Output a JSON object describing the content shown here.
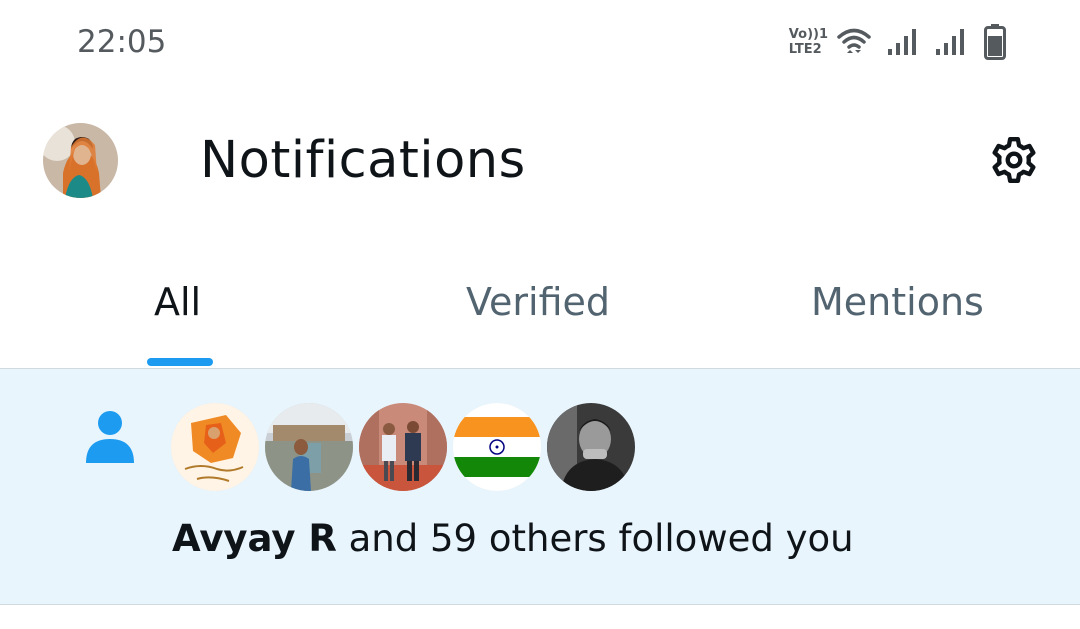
{
  "status_bar": {
    "time": "22:05",
    "volte_top": "Vo))1",
    "volte_bottom": "LTE2",
    "icons": [
      "wifi-icon",
      "signal-icon",
      "signal-icon",
      "battery-icon"
    ]
  },
  "header": {
    "title": "Notifications",
    "settings_icon": "gear-icon"
  },
  "tabs": [
    {
      "label": "All",
      "active": true
    },
    {
      "label": "Verified",
      "active": false
    },
    {
      "label": "Mentions",
      "active": false
    }
  ],
  "notification": {
    "icon": "person-icon",
    "name": "Avyay R",
    "text": " and 59 others followed you"
  },
  "colors": {
    "accent": "#1d9bf0",
    "notification_bg": "#e8f5fd",
    "text_primary": "#0f1419",
    "text_secondary": "#536471"
  }
}
